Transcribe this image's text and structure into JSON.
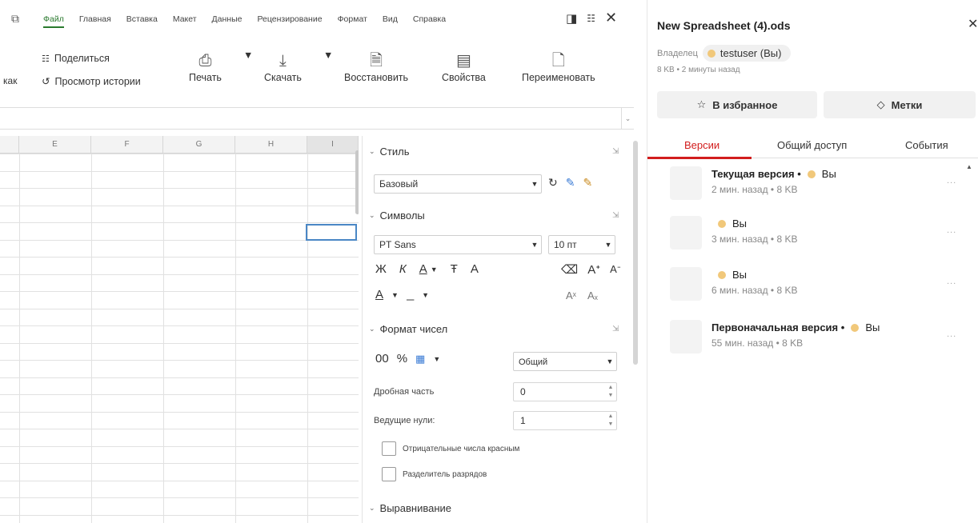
{
  "menu": {
    "items": [
      "Файл",
      "Главная",
      "Вставка",
      "Макет",
      "Данные",
      "Рецензирование",
      "Формат",
      "Вид",
      "Справка"
    ],
    "active": "Файл"
  },
  "ribbon": {
    "save_as_fragment": "как",
    "share": "Поделиться",
    "history": "Просмотр истории",
    "print": "Печать",
    "download": "Скачать",
    "restore": "Восстановить",
    "properties": "Свойства",
    "rename": "Переименовать"
  },
  "grid": {
    "columns": [
      "E",
      "F",
      "G",
      "H",
      "I"
    ]
  },
  "format_panel": {
    "style_section": "Стиль",
    "style_value": "Базовый",
    "symbols_section": "Символы",
    "font_value": "PT Sans",
    "size_value": "10 пт",
    "bold": "Ж",
    "italic": "К",
    "underline": "А",
    "strike": "Ŧ",
    "shadow": "A",
    "number_section": "Формат чисел",
    "number_buttons": [
      "00",
      "%"
    ],
    "number_format_value": "Общий",
    "fraction_label": "Дробная часть",
    "fraction_value": "0",
    "leading_label": "Ведущие нули:",
    "leading_value": "1",
    "neg_red_label": "Отрицательные числа красным",
    "thousands_label": "Разделитель разрядов",
    "align_section": "Выравнивание"
  },
  "versions_panel": {
    "title": "New Spreadsheet (4).ods",
    "owner_label": "Владелец",
    "owner_name": "testuser (Вы)",
    "meta": "8 KB • 2 минуты назад",
    "favorite_label": "В избранное",
    "tags_label": "Метки",
    "tabs": [
      "Версии",
      "Общий доступ",
      "События"
    ],
    "active_tab": "Версии",
    "versions": [
      {
        "title": "Текущая версия •",
        "author": "Вы",
        "sub": "2 мин. назад • 8 KB"
      },
      {
        "title": "",
        "author": "Вы",
        "sub": "3 мин. назад • 8 KB"
      },
      {
        "title": "",
        "author": "Вы",
        "sub": "6 мин. назад • 8 KB"
      },
      {
        "title": "Первоначальная версия •",
        "author": "Вы",
        "sub": "55 мин. назад • 8 KB"
      }
    ],
    "more_label": "..."
  },
  "colors": {
    "accent_green": "#2a7a2e",
    "accent_red": "#d21d1d",
    "selection_blue": "#4a87c5"
  }
}
